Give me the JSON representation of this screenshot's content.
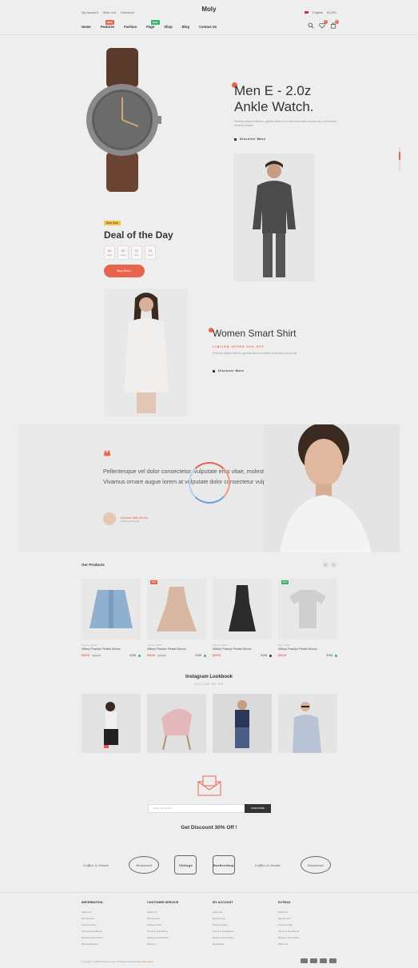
{
  "topbar": {
    "links": [
      "My Account",
      "Wish List",
      "Checkout"
    ],
    "logo": "Moly",
    "language": "English",
    "currency": "$ USD"
  },
  "nav": {
    "items": [
      {
        "label": "Home",
        "tag": ""
      },
      {
        "label": "Features",
        "tag": "NEW",
        "tag_color": "#e8654d"
      },
      {
        "label": "Fashion",
        "tag": ""
      },
      {
        "label": "Page",
        "tag": "HOT",
        "tag_color": "#3cb371"
      },
      {
        "label": "Shop",
        "tag": ""
      },
      {
        "label": "Blog",
        "tag": ""
      },
      {
        "label": "Contact Us",
        "tag": ""
      }
    ],
    "icons": {
      "search": "search-icon",
      "wishlist": "heart-icon",
      "cart": "bag-icon"
    },
    "wishlist_count": "0",
    "cart_count": "0"
  },
  "hero": {
    "title_line1": "Men E - 2.0z",
    "title_line2": "Ankle Watch.",
    "description": "Pharetra aliquet efficitur, gravida libero id ornare venenatis a lacus nisi, consectetur sit amet nullam.",
    "cta": "Discover More"
  },
  "deal": {
    "badge": "Best Sale",
    "title": "Deal of the Day",
    "countdown": [
      {
        "value": "00",
        "label": "Days"
      },
      {
        "value": "00",
        "label": "Hours"
      },
      {
        "value": "00",
        "label": "Mins"
      },
      {
        "value": "00",
        "label": "Secs"
      }
    ],
    "button": "Buy Now !"
  },
  "shirt": {
    "title": "Women Smart Shirt",
    "subtitle": "LIMITED OFFER 30% OFF",
    "description": "Pharetra aliquet efficitur, gravida libero id ornare venenatis a lacus nisi.",
    "cta": "Discover More"
  },
  "testimonial": {
    "quote": "Pellentesque vel dolor consectetur, vulputate eros vitae, molestie felis. Vivamus ornare augue lorem at vulputate dolor consectetur vulputate leo.",
    "author": "Mariam Bills Morris",
    "role": "Product Designer"
  },
  "products": {
    "heading": "Our Products",
    "items": [
      {
        "category": "Women, Jacket",
        "name": "Milltary Pinstripe Pleated Blouse",
        "price": "$39.00",
        "old_price": "$49.00",
        "rating": "5.0/5",
        "tag": "",
        "dot_color": "#3cb371"
      },
      {
        "category": "Women, Dress",
        "name": "Milltary Pinstripe Pleated Blouse",
        "price": "$39.00",
        "old_price": "$49.00",
        "rating": "5.0/5",
        "tag": "Sale",
        "tag_color": "#e8654d",
        "dot_color": "#3cb371"
      },
      {
        "category": "Women, Dress",
        "name": "Milltary Pinstripe Pleated Blouse",
        "price": "$39.00",
        "old_price": "",
        "rating": "5.0/5",
        "tag": "",
        "dot_color": "#333333"
      },
      {
        "category": "Men, T-Shirt",
        "name": "Milltary Pinstripe Pleated Blouse",
        "price": "$39.00",
        "old_price": "",
        "rating": "5.0/5",
        "tag": "New",
        "tag_color": "#3cb371",
        "dot_color": "#3cb371"
      }
    ]
  },
  "instagram": {
    "title": "Instagram Lookbook",
    "subtitle": "FOLLOW US ON"
  },
  "newsletter": {
    "placeholder": "Enter Your Email",
    "button": "SUBSCRIBE",
    "title": "Get Discount 30% Off !"
  },
  "brands": [
    "Coffee & Goods",
    "Eastwood",
    "Vintage",
    "Barbershop",
    "Coffee & Goods",
    "Eastwood"
  ],
  "footer": {
    "columns": [
      {
        "heading": "INFORMATION",
        "links": [
          "About Us",
          "My Account",
          "Privacy Policy",
          "Terms & Conditions",
          "Delivery Information",
          "Gift Certificates"
        ]
      },
      {
        "heading": "CUSTOMER SERVICE",
        "links": [
          "About Us",
          "My Account",
          "Privacy Policy",
          "Terms & Conditions",
          "Delivery Information",
          "Returns"
        ]
      },
      {
        "heading": "MY ACCOUNT",
        "links": [
          "About Us",
          "My Account",
          "Privacy Policy",
          "Terms & Conditions",
          "Delivery Information",
          "Newsletter"
        ]
      },
      {
        "heading": "EXTRAS",
        "links": [
          "About Us",
          "My Account",
          "Privacy Policy",
          "Terms & Conditions",
          "Delivery Information",
          "Wish List"
        ]
      }
    ],
    "copyright": "Copyright © 2020 Fashion store. All Rights Reserved By",
    "copyright_brand": "Moly Store",
    "payments": [
      "visa-icon",
      "mastercard-icon",
      "paypal-icon",
      "amex-icon"
    ]
  }
}
